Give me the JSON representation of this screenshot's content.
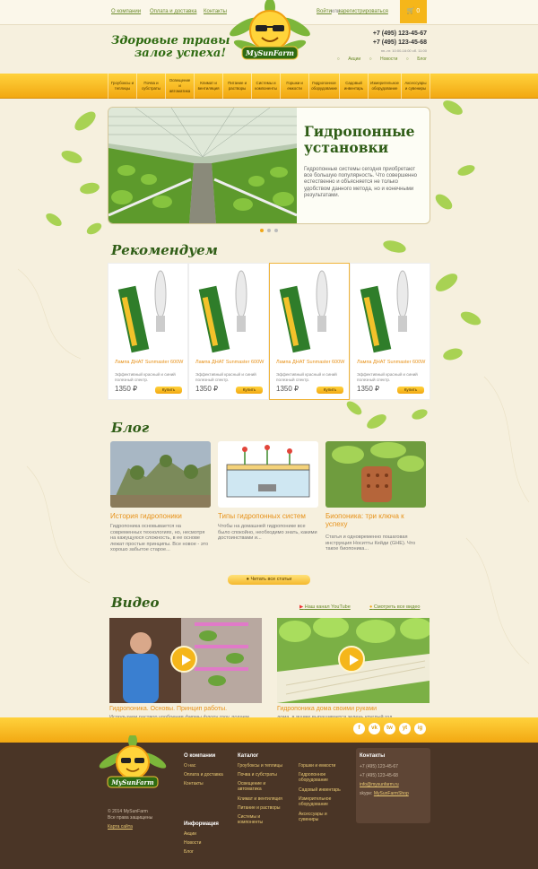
{
  "topbar": {
    "links": [
      "О компании",
      "Оплата и доставка",
      "Контакты"
    ],
    "login": "Войти",
    "or": "или",
    "register": "зарегистрироваться",
    "cart_count": "0"
  },
  "header": {
    "slogan_line1": "Здоровые травы",
    "slogan_line2": "залог успеха!",
    "logo_text": "MySunFarm",
    "phone1": "+7 (495) 123-45-67",
    "phone2": "+7 (495) 123-45-68",
    "hours": "пн.-пт. 10:00-16:00 сб. 11:00",
    "links": [
      "Акции",
      "Новости",
      "Блог"
    ]
  },
  "nav": {
    "items": [
      "Гроубоксы и теплицы",
      "Почва и субстраты",
      "Освещение и автоматика",
      "Климат и вентиляция",
      "Питание и растворы",
      "Системы и компоненты",
      "Горшки и емкости",
      "Гидропонное оборудование",
      "Садовый инвентарь",
      "Измерительное оборудование",
      "Аксессуары и сувениры"
    ]
  },
  "hero": {
    "title_line1": "Гидропонные",
    "title_line2": "установки",
    "text": "Гидропонные системы сегодня приобретают все большую популярность. Что совершенно естественно и объясняется не только удобством данного метода, но и конечными результатами."
  },
  "recommend": {
    "title": "Рекомендуем",
    "products": [
      {
        "name": "Лампа ДНАТ Sunmaster 600W",
        "desc": "Эффективный красный и синий полезный спектр.",
        "price": "1350 ₽",
        "buy": "Купить"
      },
      {
        "name": "Лампа ДНАТ Sunmaster 600W",
        "desc": "Эффективный красный и синий полезный спектр.",
        "price": "1350 ₽",
        "buy": "Купить"
      },
      {
        "name": "Лампа ДНАТ Sunmaster 600W",
        "desc": "Эффективный красный и синий полезный спектр.",
        "price": "1350 ₽",
        "buy": "Купить"
      },
      {
        "name": "Лампа ДНАТ Sunmaster 600W",
        "desc": "Эффективный красный и синий полезный спектр.",
        "price": "1350 ₽",
        "buy": "Купить"
      }
    ]
  },
  "blog": {
    "title": "Блог",
    "posts": [
      {
        "title": "История гидропоники",
        "text": "Гидропоника основывается на современных технологиях, но, несмотря на кажущуюся сложность, в ее основе лежат простые принципы. Все новое - это хорошо забытое старое..."
      },
      {
        "title": "Типы гидропонных систем",
        "text": "Чтобы на домашней гидропонике все было спокойно, необходимо знать, какими достоинствами и..."
      },
      {
        "title": "Биопоника: три ключа к успеху",
        "text": "Статья и одновременно пошаговая инструкция Носитты Кейди (GHE). Что такое биопоника..."
      }
    ],
    "all_button": "Читать все статьи"
  },
  "video": {
    "title": "Видео",
    "youtube": "Наш канал YouTube",
    "all": "Смотреть все видео",
    "items": [
      {
        "title": "Гидропоника. Основы. Принцип работы.",
        "text": "Используем раствор удобрения фирмы флору гроу, подаем жидкости каждый час на пару минут, освещение лампами..."
      },
      {
        "title": "Гидропоника дома своими руками",
        "text": "дома, в ящике выращивается зелень круглый год, энергопотребление порядка 3 квт."
      }
    ]
  },
  "footer": {
    "social": [
      "f",
      "vk",
      "tw",
      "yt",
      "ig"
    ],
    "copyright1": "© 2014 MySunFarm",
    "copyright2": "Все права защищены",
    "sitemap": "Карта сайта",
    "company_title": "О компании",
    "company_links": [
      "О нас",
      "Оплата и доставка",
      "Контакты"
    ],
    "info_title": "Информация",
    "info_links": [
      "Акции",
      "Новости",
      "Блог"
    ],
    "catalog_title": "Каталог",
    "catalog_col1": [
      "Гроубоксы и теплицы",
      "Почва и субстраты",
      "Освещение и автоматика",
      "Климат и вентиляция",
      "Питание и растворы",
      "Системы и компоненты"
    ],
    "catalog_col2": [
      "Горшки и емкости",
      "Гидропонное оборудование",
      "Садовый инвентарь",
      "Измерительное оборудование",
      "Аксессуары и сувениры"
    ],
    "contacts_title": "Контакты",
    "contact_phone1": "+7 (495) 123-45-67",
    "contact_phone2": "+7 (495) 123-45-68",
    "contact_email": "info@mysunfarm.ru",
    "skype_label": "skype:",
    "skype": "MySunFarmShop"
  }
}
